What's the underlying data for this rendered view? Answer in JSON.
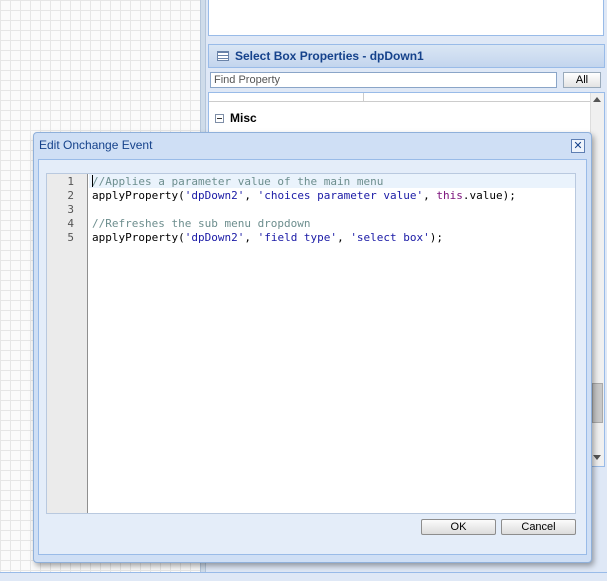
{
  "properties_panel": {
    "title": "Select Box Properties - dpDown1",
    "find_placeholder": "Find Property",
    "all_label": "All",
    "group_label": "Misc"
  },
  "dialog": {
    "title": "Edit Onchange Event",
    "close_glyph": "✕",
    "ok_label": "OK",
    "cancel_label": "Cancel",
    "code_lines": [
      {
        "num": "1",
        "text": "//Applies a parameter value of the main menu"
      },
      {
        "num": "2",
        "text": "applyProperty('dpDown2', 'choices parameter value', this.value);"
      },
      {
        "num": "3",
        "text": ""
      },
      {
        "num": "4",
        "text": "//Refreshes the sub menu dropdown"
      },
      {
        "num": "5",
        "text": "applyProperty('dpDown2', 'field type', 'select box');"
      }
    ]
  }
}
